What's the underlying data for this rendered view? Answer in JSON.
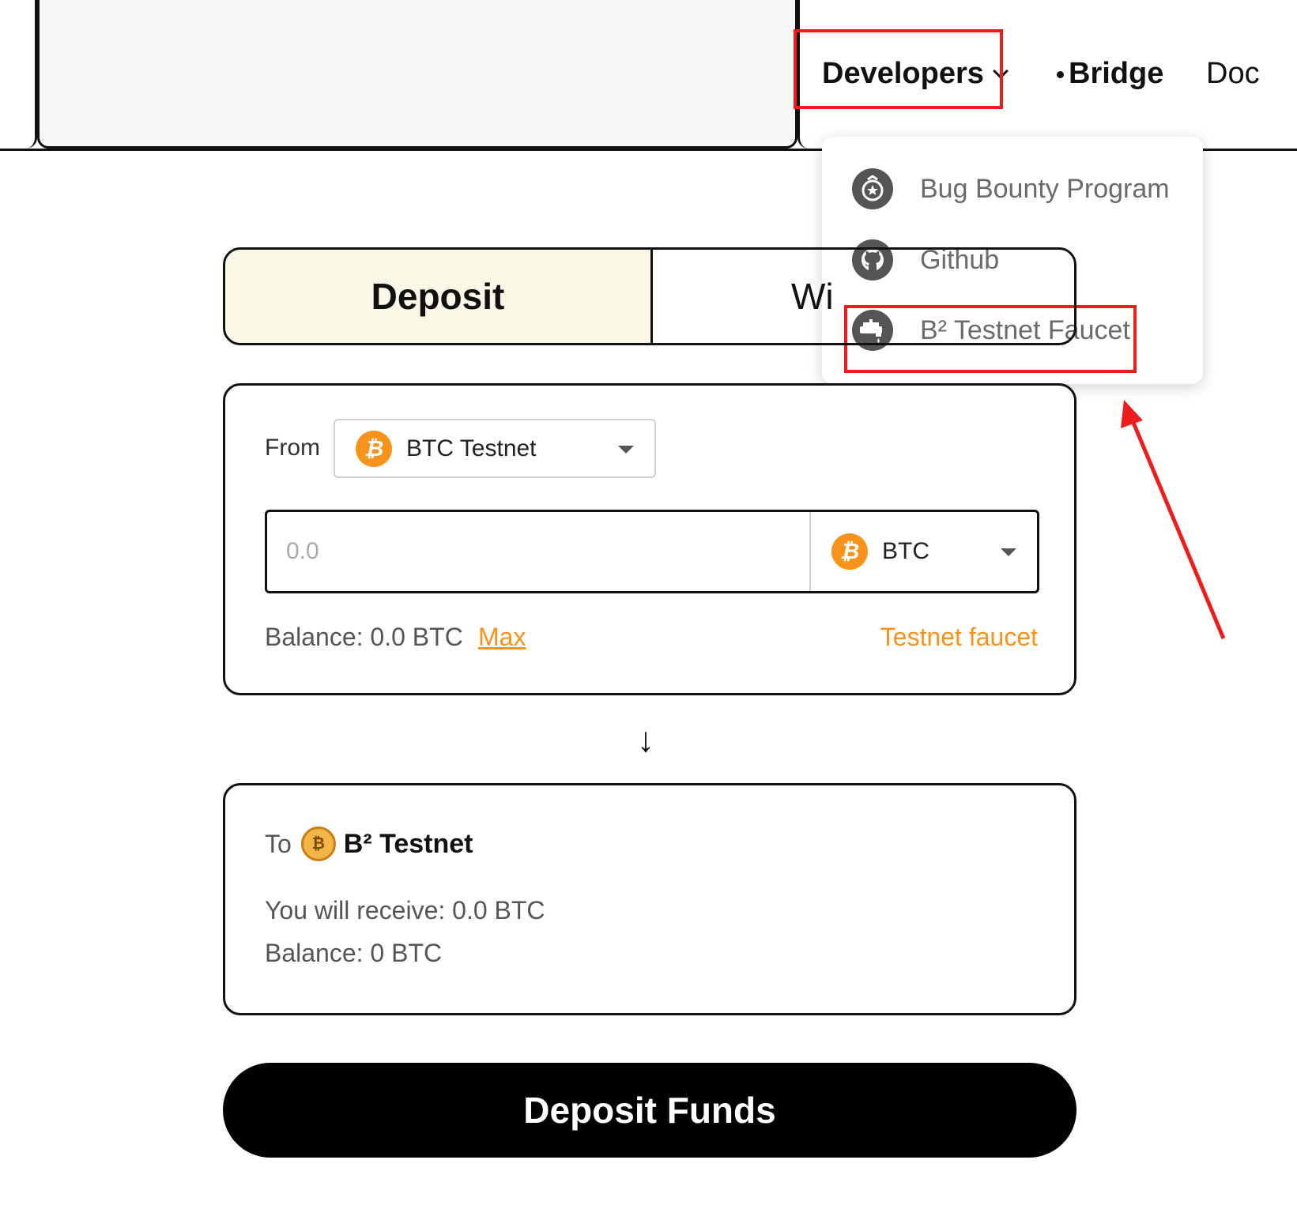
{
  "header": {
    "nav": {
      "developers_label": "Developers",
      "bridge_label": "Bridge",
      "doc_label": "Doc"
    }
  },
  "developers_menu": {
    "items": [
      {
        "label": "Bug Bounty Program",
        "icon": "medal-icon"
      },
      {
        "label": "Github",
        "icon": "github-icon"
      },
      {
        "label": "B² Testnet Faucet",
        "icon": "faucet-icon"
      }
    ]
  },
  "tabs": {
    "deposit_label": "Deposit",
    "withdraw_label": "Wi"
  },
  "from_card": {
    "label": "From",
    "network": "BTC Testnet",
    "amount_placeholder": "0.0",
    "token": "BTC",
    "balance": "Balance: 0.0 BTC",
    "max_label": "Max",
    "faucet_label": "Testnet faucet"
  },
  "to_card": {
    "label": "To",
    "network": "B² Testnet",
    "receive": "You will receive: 0.0 BTC",
    "balance": "Balance: 0 BTC"
  },
  "submit": {
    "label": "Deposit Funds"
  },
  "colors": {
    "accent": "#f7931a",
    "annotation": "#ee1d1d",
    "deposit_tab_bg": "#fbf7e6"
  }
}
